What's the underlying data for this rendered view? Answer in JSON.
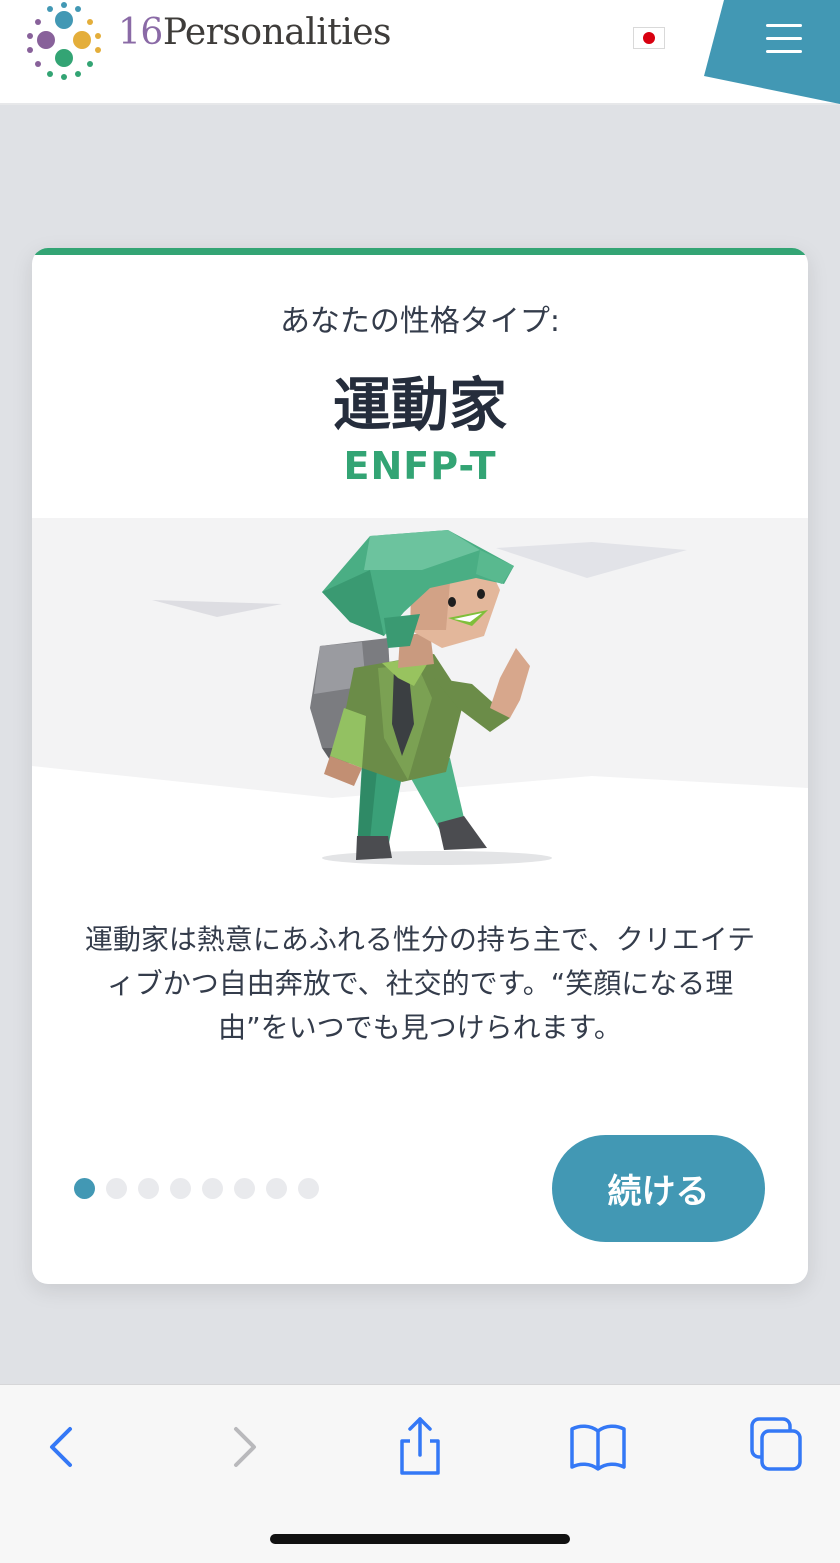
{
  "header": {
    "logo_number": "16",
    "logo_word": "Personalities",
    "language_flag": "japan-flag",
    "menu_icon": "hamburger-menu-icon",
    "accent_color": "#4298b4"
  },
  "card": {
    "subtitle": "あなたの性格タイプ:",
    "type_name": "運動家",
    "type_code": "ENFP-T",
    "description": "運動家は熱意にあふれる性分の持ち主で、クリエイティブかつ自由奔放で、社交的です。“笑顔になる理由”をいつでも見つけられます。",
    "illustration": "enfp-campaigner-character",
    "progress": {
      "current": 1,
      "total": 8
    },
    "continue_label": "続ける",
    "colors": {
      "top_bar": "#33a474",
      "type_code": "#33a474",
      "button": "#4298b4"
    }
  },
  "toolbar": {
    "items": [
      "back-icon",
      "forward-icon",
      "share-icon",
      "bookmarks-icon",
      "tabs-icon"
    ]
  }
}
